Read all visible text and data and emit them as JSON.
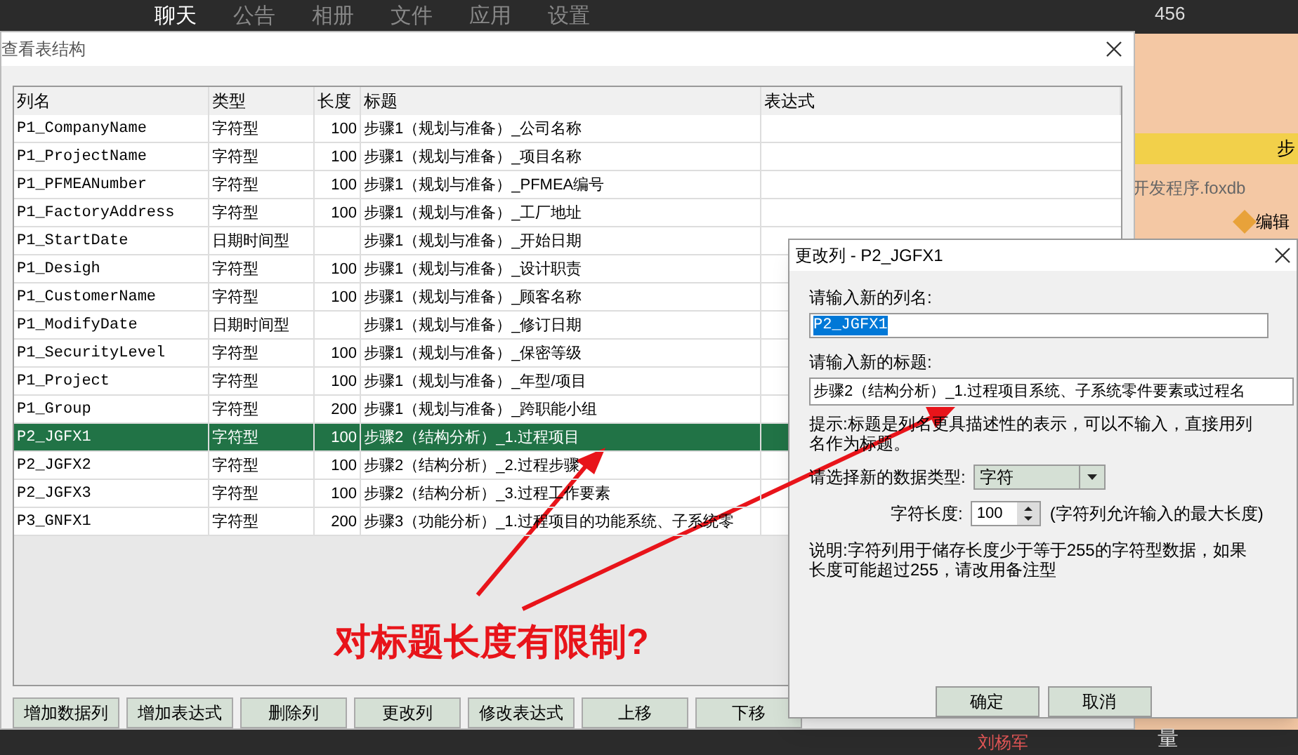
{
  "background_app": {
    "tabs": [
      {
        "label": "聊天",
        "selected": true
      },
      {
        "label": "公告",
        "selected": false
      },
      {
        "label": "相册",
        "selected": false
      },
      {
        "label": "文件",
        "selected": false
      },
      {
        "label": "应用",
        "selected": false
      },
      {
        "label": "设置",
        "selected": false
      }
    ],
    "corner_text": "456",
    "yellow_bar_text": "步",
    "file_name": "开发程序.foxdb",
    "edit_button": "编辑",
    "bottom_text": "量",
    "contact_name": "刘杨军"
  },
  "window": {
    "title": "查看表结构"
  },
  "table": {
    "columns": [
      "列名",
      "类型",
      "长度",
      "标题",
      "表达式"
    ],
    "rows": [
      {
        "name": "P1_CompanyName",
        "type": "字符型",
        "length": "100",
        "title": "步骤1（规划与准备）_公司名称",
        "selected": false
      },
      {
        "name": "P1_ProjectName",
        "type": "字符型",
        "length": "100",
        "title": "步骤1（规划与准备）_项目名称",
        "selected": false
      },
      {
        "name": "P1_PFMEANumber",
        "type": "字符型",
        "length": "100",
        "title": "步骤1（规划与准备）_PFMEA编号",
        "selected": false
      },
      {
        "name": "P1_FactoryAddress",
        "type": "字符型",
        "length": "100",
        "title": "步骤1（规划与准备）_工厂地址",
        "selected": false
      },
      {
        "name": "P1_StartDate",
        "type": "日期时间型",
        "length": "",
        "title": "步骤1（规划与准备）_开始日期",
        "selected": false
      },
      {
        "name": "P1_Desigh",
        "type": "字符型",
        "length": "100",
        "title": "步骤1（规划与准备）_设计职责",
        "selected": false
      },
      {
        "name": "P1_CustomerName",
        "type": "字符型",
        "length": "100",
        "title": "步骤1（规划与准备）_顾客名称",
        "selected": false
      },
      {
        "name": "P1_ModifyDate",
        "type": "日期时间型",
        "length": "",
        "title": "步骤1（规划与准备）_修订日期",
        "selected": false
      },
      {
        "name": "P1_SecurityLevel",
        "type": "字符型",
        "length": "100",
        "title": "步骤1（规划与准备）_保密等级",
        "selected": false
      },
      {
        "name": "P1_Project",
        "type": "字符型",
        "length": "100",
        "title": "步骤1（规划与准备）_年型/项目",
        "selected": false
      },
      {
        "name": "P1_Group",
        "type": "字符型",
        "length": "200",
        "title": "步骤1（规划与准备）_跨职能小组",
        "selected": false
      },
      {
        "name": "P2_JGFX1",
        "type": "字符型",
        "length": "100",
        "title": "步骤2（结构分析）_1.过程项目",
        "selected": true
      },
      {
        "name": "P2_JGFX2",
        "type": "字符型",
        "length": "100",
        "title": "步骤2（结构分析）_2.过程步骤",
        "selected": false
      },
      {
        "name": "P2_JGFX3",
        "type": "字符型",
        "length": "100",
        "title": "步骤2（结构分析）_3.过程工作要素",
        "selected": false
      },
      {
        "name": "P3_GNFX1",
        "type": "字符型",
        "length": "200",
        "title": "步骤3（功能分析）_1.过程项目的功能系统、子系统零",
        "selected": false
      }
    ]
  },
  "buttons": [
    "增加数据列",
    "增加表达式",
    "删除列",
    "更改列",
    "修改表达式",
    "上移",
    "下移"
  ],
  "annotation": "对标题长度有限制?",
  "dialog": {
    "title": "更改列 - P2_JGFX1",
    "name_label": "请输入新的列名:",
    "name_value": "P2_JGFX1",
    "title_label": "请输入新的标题:",
    "title_value": "步骤2（结构分析）_1.过程项目系统、子系统零件要素或过程名",
    "hint": "提示:标题是列名更具描述性的表示，可以不输入，直接用列名作为标题。",
    "type_label": "请选择新的数据类型:",
    "type_value": "字符",
    "length_label": "字符长度:",
    "length_value": "100",
    "length_note": "(字符列允许输入的最大长度)",
    "note": "说明:字符列用于储存长度少于等于255的字符型数据，如果长度可能超过255，请改用备注型",
    "buttons": [
      "确定",
      "取消"
    ]
  }
}
